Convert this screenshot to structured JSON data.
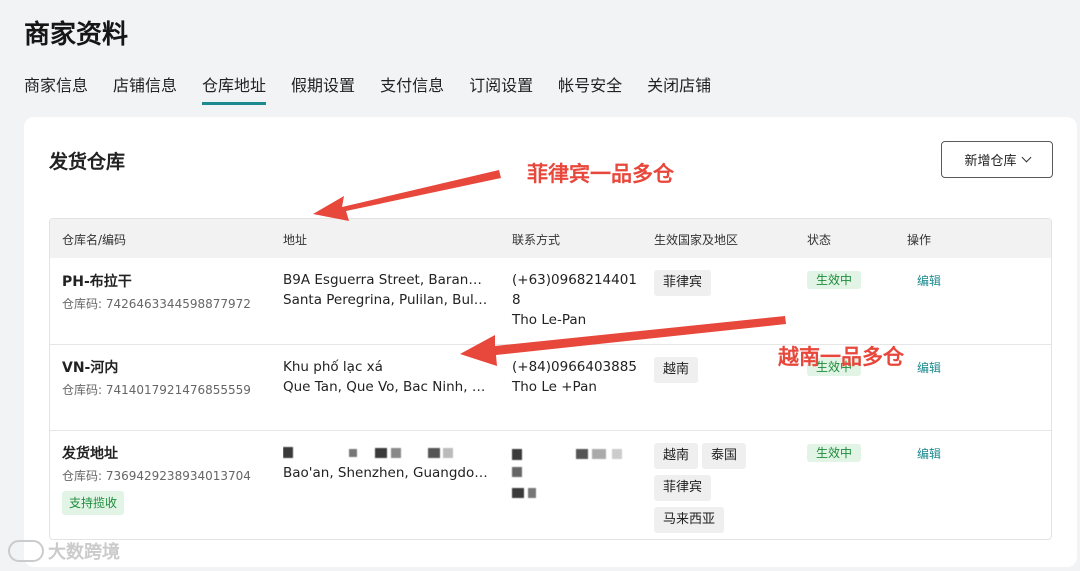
{
  "page": {
    "title": "商家资料"
  },
  "tabs": [
    {
      "label": "商家信息",
      "active": false
    },
    {
      "label": "店铺信息",
      "active": false
    },
    {
      "label": "仓库地址",
      "active": true
    },
    {
      "label": "假期设置",
      "active": false
    },
    {
      "label": "支付信息",
      "active": false
    },
    {
      "label": "订阅设置",
      "active": false
    },
    {
      "label": "帐号安全",
      "active": false
    },
    {
      "label": "关闭店铺",
      "active": false
    }
  ],
  "card": {
    "title": "发货仓库",
    "add_button": "新增仓库"
  },
  "table": {
    "headers": {
      "name": "仓库名/编码",
      "address": "地址",
      "contact": "联系方式",
      "region": "生效国家及地区",
      "status": "状态",
      "action": "操作"
    },
    "rows": [
      {
        "name": "PH-布拉干",
        "code": "仓库码: 7426463344598877972",
        "address_line1": "B9A Esguerra Street, Barangay...",
        "address_line2": "Santa Peregrina, Pulilan, Bulacan...",
        "contact_phone": "(+63)09682144018",
        "contact_name": "Tho Le-Pan",
        "regions": [
          "菲律宾"
        ],
        "status": "生效中",
        "action": "编辑"
      },
      {
        "name": "VN-河内",
        "code": "仓库码: 7414017921476855559",
        "address_line1": "Khu phố lạc xá",
        "address_line2": "Que Tan, Que Vo, Bac Ninh, V...",
        "contact_phone": "(+84)0966403885",
        "contact_name": "Tho Le +Pan",
        "regions": [
          "越南"
        ],
        "status": "生效中",
        "action": "编辑"
      },
      {
        "name": "发货地址",
        "code": "仓库码: 7369429238934013704",
        "tag": "支持揽收",
        "address_line1": "",
        "address_line2": "Bao'an, Shenzhen, Guangdong...",
        "contact_phone": "",
        "contact_name": "",
        "regions": [
          "越南",
          "泰国",
          "菲律宾",
          "马来西亚"
        ],
        "status": "生效中",
        "action": "编辑"
      }
    ]
  },
  "annotations": {
    "ph": "菲律宾一品多仓",
    "vn": "越南一品多仓"
  },
  "watermark": "大数跨境",
  "colors": {
    "accent": "#1d8a8f",
    "annotation": "#e8473b",
    "status_green": "#1e8c3a"
  }
}
